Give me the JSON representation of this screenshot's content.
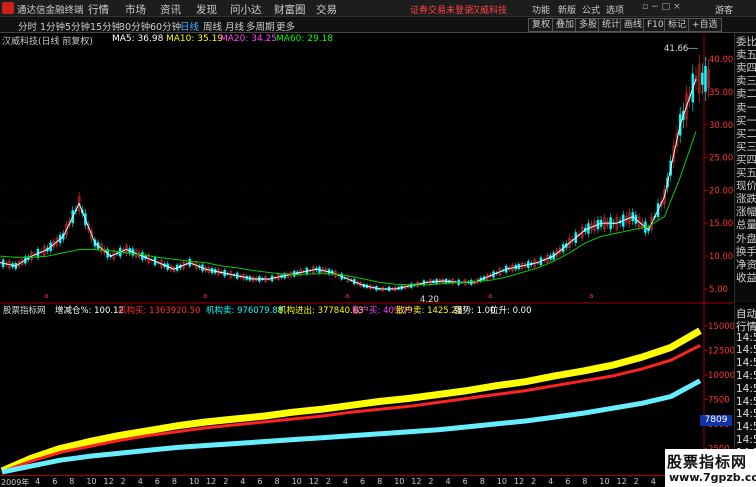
{
  "menubar": {
    "app_name": "通达信金融终端",
    "items": [
      "行情",
      "市场",
      "资讯",
      "发现",
      "问小达",
      "财富圈",
      "交易"
    ],
    "notice": "证券交易未登录",
    "stock_name": "汉威科技",
    "right_items": [
      "功能",
      "新版",
      "公式",
      "选项"
    ],
    "guest": "游客"
  },
  "toolbar": {
    "periods": [
      "分时",
      "1分钟",
      "5分钟",
      "15分钟",
      "30分钟",
      "60分钟",
      "日线",
      "周线",
      "月线",
      "多周期",
      "更多"
    ],
    "active_period": "日线",
    "buttons": [
      "复权",
      "叠加",
      "多股",
      "统计",
      "画线",
      "F10",
      "标记",
      "+自选"
    ]
  },
  "info": {
    "stock_label": "汉威科技(日线 前复权)",
    "ma5": "MA5: 36.98",
    "ma10": "MA10: 35.19",
    "ma20": "MA20: 34.25",
    "ma60": "MA60: 29.18",
    "colors": {
      "ma5": "#ffffff",
      "ma10": "#ffff00",
      "ma20": "#ff44ff",
      "ma60": "#00ff00"
    }
  },
  "chart_data": [
    {
      "type": "line",
      "title": "汉威科技(日线 前复权)",
      "y_ticks": [
        "40.00",
        "35.00",
        "30.00",
        "25.00",
        "20.00",
        "15.00",
        "10.00",
        "5.00"
      ],
      "ylim": [
        3,
        42
      ],
      "annotations": {
        "high": "41.66",
        "low": "4.20"
      },
      "series": [
        {
          "name": "MA5",
          "values": [
            9,
            8.5,
            10,
            11,
            13,
            18,
            12,
            10,
            11,
            10,
            9,
            8,
            9,
            8,
            7.5,
            7,
            6.5,
            6.5,
            7,
            7.5,
            8,
            7.5,
            6.5,
            5.5,
            5,
            5,
            5.5,
            6,
            6.2,
            6,
            6,
            7,
            8,
            8.5,
            9,
            10,
            12,
            14,
            15,
            15,
            16,
            14,
            19,
            30,
            37
          ]
        },
        {
          "name": "MA60",
          "values": [
            10,
            9.8,
            9.8,
            10,
            10.5,
            11,
            11,
            10.8,
            10.5,
            10.2,
            9.8,
            9.5,
            9.2,
            9,
            8.5,
            8.2,
            7.8,
            7.5,
            7.2,
            7.2,
            7.3,
            7.3,
            7,
            6.5,
            6,
            5.7,
            5.6,
            5.6,
            5.8,
            6,
            6.1,
            6.3,
            6.8,
            7.5,
            8.2,
            9.2,
            10.5,
            12,
            13,
            13.5,
            14,
            14.5,
            16,
            22,
            29
          ]
        }
      ]
    },
    {
      "type": "area",
      "title": "股票指标网",
      "y_ticks": [
        "15000",
        "12500",
        "10000",
        "7500",
        "5000",
        "2500"
      ],
      "ylim": [
        0,
        16000
      ],
      "last_value": "7809",
      "series": [
        {
          "name": "机构买",
          "values": [
            200,
            1500,
            2500,
            3200,
            3800,
            4300,
            4800,
            5200,
            5500,
            5800,
            6200,
            6500,
            6900,
            7300,
            7600,
            8000,
            8400,
            8900,
            9300,
            9900,
            10400,
            11000,
            11800,
            12800,
            14500
          ]
        },
        {
          "name": "散户卖",
          "values": [
            150,
            1200,
            2100,
            2700,
            3300,
            3800,
            4200,
            4600,
            4900,
            5200,
            5500,
            5800,
            6200,
            6500,
            6800,
            7200,
            7600,
            8000,
            8400,
            8900,
            9400,
            9900,
            10600,
            11500,
            13000
          ]
        },
        {
          "name": "机构卖",
          "values": [
            100,
            700,
            1300,
            1700,
            2000,
            2300,
            2600,
            2800,
            3000,
            3200,
            3400,
            3600,
            3800,
            4000,
            4200,
            4400,
            4700,
            5000,
            5300,
            5700,
            6100,
            6600,
            7100,
            7800,
            9400
          ]
        }
      ]
    }
  ],
  "indicator": {
    "name": "股票指标网",
    "items": [
      {
        "text": "增减仓%: 100.12",
        "color": "#ffffff"
      },
      {
        "text": "机构买: 1363920.50",
        "color": "#ff3333"
      },
      {
        "text": "机构卖: 976079.88",
        "color": "#00ffff"
      },
      {
        "text": "机构进出: 377840.63",
        "color": "#ffff00"
      },
      {
        "text": "散户买: 409.79",
        "color": "#ff44ff"
      },
      {
        "text": "散户卖: 1425.28",
        "color": "#ffff00"
      },
      {
        "text": "强势: 1.00",
        "color": "#ffffff"
      },
      {
        "text": "拉升: 0.00",
        "color": "#ffffff"
      }
    ]
  },
  "right_panel": [
    "委比",
    "卖五",
    "卖四",
    "卖三",
    "卖二",
    "卖一",
    "买一",
    "买二",
    "买三",
    "买四",
    "买五",
    "现价",
    "涨跌",
    "涨幅",
    "总量",
    "外盘",
    "换手",
    "净资",
    "收益"
  ],
  "right_panel2": [
    "自动",
    "行情",
    "14:5",
    "14:5",
    "14:5",
    "14:5",
    "14:5",
    "14:5",
    "14:5",
    "14:5",
    "14:5",
    "14:5"
  ],
  "timeline": [
    "2009年",
    "4",
    "6",
    "8",
    "10",
    "12",
    "2",
    "4",
    "6",
    "8",
    "10",
    "12",
    "2",
    "4",
    "6",
    "8",
    "10",
    "12",
    "2",
    "4",
    "6",
    "8",
    "10",
    "12",
    "2",
    "4",
    "6",
    "8",
    "10",
    "12",
    "2",
    "4",
    "6",
    "8",
    "10",
    "12",
    "2",
    "4",
    "6",
    "8",
    "10"
  ],
  "watermark": {
    "line1": "股票指标网",
    "line2": "www.7gpzb.com"
  }
}
